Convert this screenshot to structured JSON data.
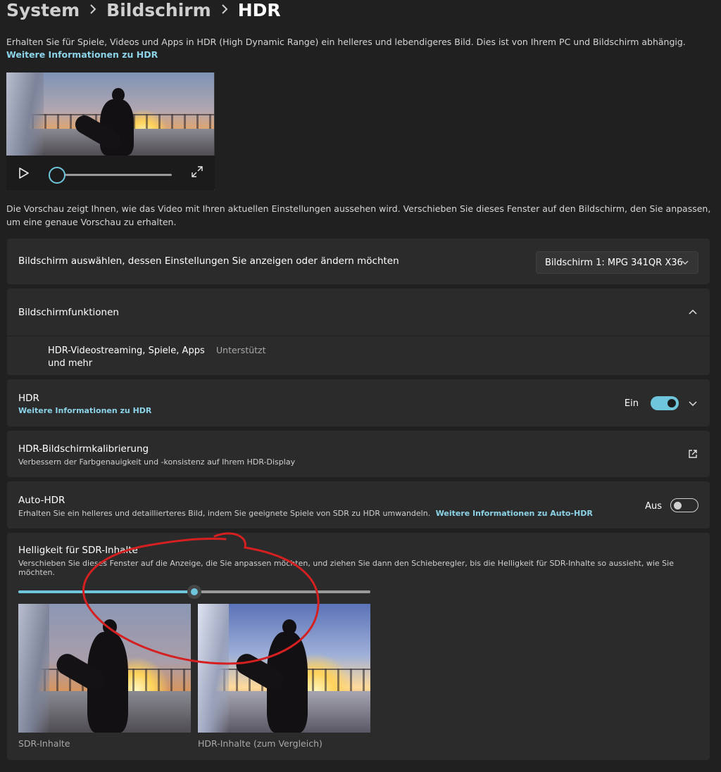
{
  "breadcrumb": {
    "items": [
      "System",
      "Bildschirm",
      "HDR"
    ]
  },
  "intro": {
    "text": "Erhalten Sie für Spiele, Videos und Apps in HDR (High Dynamic Range) ein helleres und lebendigeres Bild. Dies ist von Ihrem PC und Bildschirm abhängig.",
    "link": "Weitere Informationen zu HDR"
  },
  "video_preview": {
    "progress": 0.0
  },
  "preview_note": "Die Vorschau zeigt Ihnen, wie das Video mit Ihren aktuellen Einstellungen aussehen wird. Verschieben Sie dieses Fenster auf den Bildschirm, den Sie anpassen, um eine genaue Vorschau zu erhalten.",
  "display_select": {
    "label": "Bildschirm auswählen, dessen Einstellungen Sie anzeigen oder ändern möchten",
    "value": "Bildschirm 1: MPG 341QR X36"
  },
  "capabilities": {
    "title": "Bildschirmfunktionen",
    "feature_line1": "HDR-Videostreaming, Spiele, Apps",
    "feature_line2": "und mehr",
    "status": "Unterstützt"
  },
  "hdr": {
    "title": "HDR",
    "link": "Weitere Informationen zu HDR",
    "state": "Ein",
    "enabled": true
  },
  "calibration": {
    "title": "HDR-Bildschirmkalibrierung",
    "subtitle": "Verbessern der Farbgenauigkeit und -konsistenz auf Ihrem HDR-Display"
  },
  "auto_hdr": {
    "title": "Auto-HDR",
    "subtitle": "Erhalten Sie ein helleres und detaillierteres Bild, indem Sie geeignete Spiele von SDR zu HDR umwandeln.",
    "link": "Weitere Informationen zu Auto-HDR",
    "state": "Aus",
    "enabled": false
  },
  "sdr_brightness": {
    "title": "Helligkeit für SDR-Inhalte",
    "subtitle": "Verschieben Sie dieses Fenster auf die Anzeige, die Sie anpassen möchten, und ziehen Sie dann den Schieberegler, bis die Helligkeit für SDR-Inhalte so aussieht, wie Sie möchten.",
    "slider_value": 0.5,
    "sdr_caption": "SDR-Inhalte",
    "hdr_caption": "HDR-Inhalte (zum Vergleich)"
  },
  "colors": {
    "accent": "#6fc6dc",
    "link": "#8cd3e8",
    "card": "#2b2b2b",
    "background": "#202020",
    "annotation": "#d42020"
  }
}
